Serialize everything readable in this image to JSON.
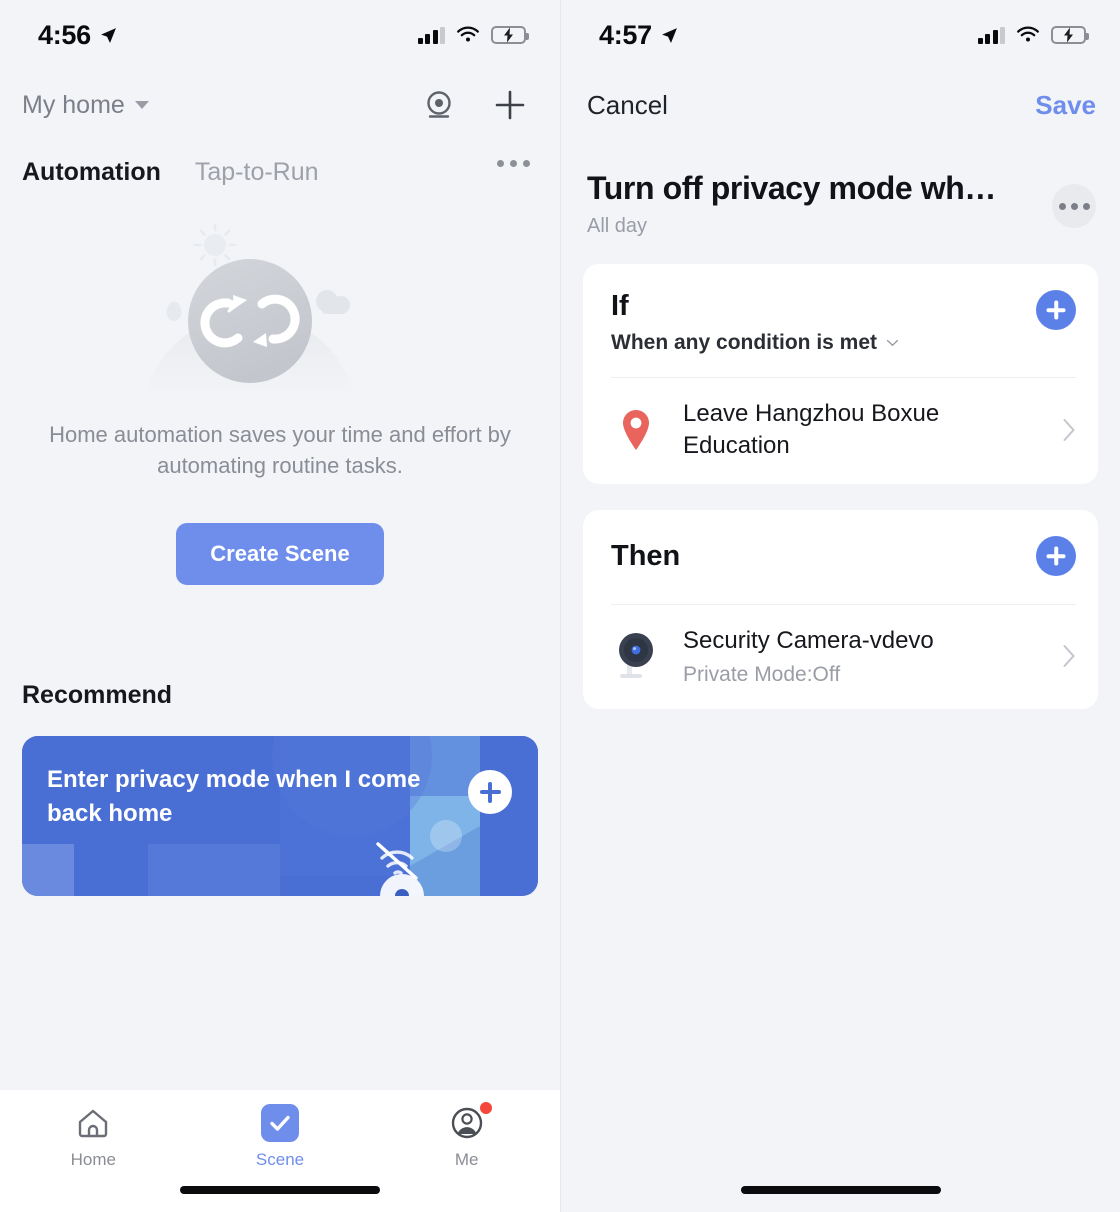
{
  "colors": {
    "background": "#f2f4f8",
    "card": "#ffffff",
    "accent_blue": "#6f8eec",
    "plus_blue": "#5b80e8",
    "pin_red": "#e8645c",
    "badge_red": "#f4483c",
    "battery_green": "#4cd45e",
    "text_primary": "#16181d",
    "text_muted": "#9a9da5",
    "recommend_card": "#4a6fd4"
  },
  "left_screen": {
    "status_bar": {
      "time": "4:56",
      "location_icon": "location-arrow-icon",
      "signal_icon": "cellular-signal-icon",
      "wifi_icon": "wifi-icon",
      "battery_icon": "battery-charging-icon"
    },
    "nav": {
      "home_name": "My home",
      "caret_icon": "chevron-down-icon",
      "camera_icon": "webcam-icon",
      "add_icon": "plus-icon"
    },
    "tabs": [
      {
        "label": "Automation",
        "active": true
      },
      {
        "label": "Tap-to-Run",
        "active": false
      }
    ],
    "overflow_icon": "ellipsis-icon",
    "empty_state": {
      "illustration": "automation-loop-illustration",
      "message": "Home automation saves your time and effort by automating routine tasks.",
      "button_label": "Create Scene"
    },
    "recommend": {
      "heading": "Recommend",
      "card": {
        "title": "Enter privacy mode when I come back home",
        "add_icon": "plus-circle-icon",
        "wifi_off_icon": "wifi-off-icon",
        "camera_icon": "camera-icon"
      }
    },
    "tabbar": [
      {
        "label": "Home",
        "icon": "home-icon",
        "active": false,
        "badge": false
      },
      {
        "label": "Scene",
        "icon": "check-icon",
        "active": true,
        "badge": false
      },
      {
        "label": "Me",
        "icon": "user-circle-icon",
        "active": false,
        "badge": true
      }
    ]
  },
  "right_screen": {
    "status_bar": {
      "time": "4:57",
      "location_icon": "location-arrow-icon",
      "signal_icon": "cellular-signal-icon",
      "wifi_icon": "wifi-icon",
      "battery_icon": "battery-charging-icon"
    },
    "edit_bar": {
      "cancel_label": "Cancel",
      "save_label": "Save"
    },
    "scene": {
      "title": "Turn off privacy mode wh…",
      "subtitle": "All day",
      "overflow_icon": "ellipsis-icon"
    },
    "if_card": {
      "title": "If",
      "condition_mode": "When any condition is met",
      "condition_caret_icon": "chevron-down-icon",
      "add_icon": "plus-circle-icon",
      "items": [
        {
          "icon": "map-pin-icon",
          "title": "Leave Hangzhou Boxue Education",
          "chevron_icon": "chevron-right-icon"
        }
      ]
    },
    "then_card": {
      "title": "Then",
      "add_icon": "plus-circle-icon",
      "items": [
        {
          "icon": "security-camera-icon",
          "title": "Security Camera-vdevo",
          "subtitle": "Private Mode:Off",
          "chevron_icon": "chevron-right-icon"
        }
      ]
    }
  }
}
